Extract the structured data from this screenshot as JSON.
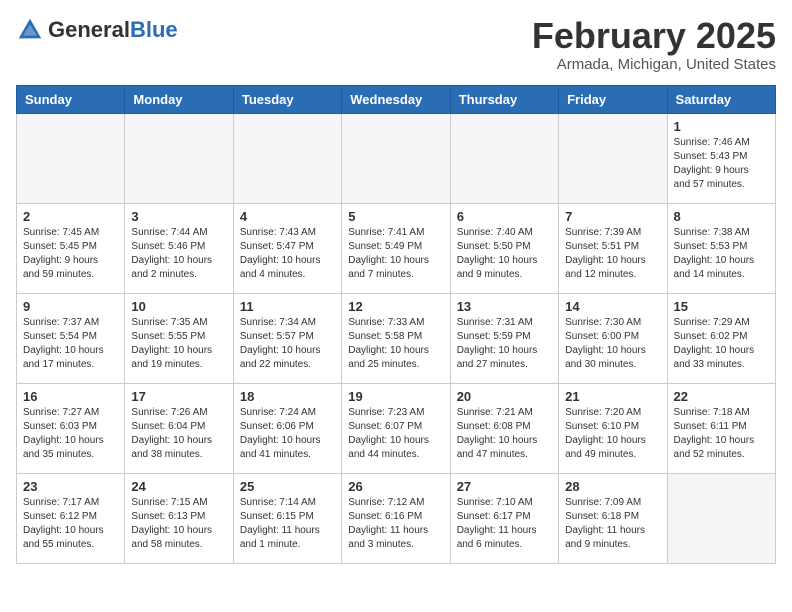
{
  "header": {
    "logo_general": "General",
    "logo_blue": "Blue",
    "month_title": "February 2025",
    "location": "Armada, Michigan, United States"
  },
  "weekdays": [
    "Sunday",
    "Monday",
    "Tuesday",
    "Wednesday",
    "Thursday",
    "Friday",
    "Saturday"
  ],
  "weeks": [
    [
      {
        "day": "",
        "info": ""
      },
      {
        "day": "",
        "info": ""
      },
      {
        "day": "",
        "info": ""
      },
      {
        "day": "",
        "info": ""
      },
      {
        "day": "",
        "info": ""
      },
      {
        "day": "",
        "info": ""
      },
      {
        "day": "1",
        "info": "Sunrise: 7:46 AM\nSunset: 5:43 PM\nDaylight: 9 hours\nand 57 minutes."
      }
    ],
    [
      {
        "day": "2",
        "info": "Sunrise: 7:45 AM\nSunset: 5:45 PM\nDaylight: 9 hours\nand 59 minutes."
      },
      {
        "day": "3",
        "info": "Sunrise: 7:44 AM\nSunset: 5:46 PM\nDaylight: 10 hours\nand 2 minutes."
      },
      {
        "day": "4",
        "info": "Sunrise: 7:43 AM\nSunset: 5:47 PM\nDaylight: 10 hours\nand 4 minutes."
      },
      {
        "day": "5",
        "info": "Sunrise: 7:41 AM\nSunset: 5:49 PM\nDaylight: 10 hours\nand 7 minutes."
      },
      {
        "day": "6",
        "info": "Sunrise: 7:40 AM\nSunset: 5:50 PM\nDaylight: 10 hours\nand 9 minutes."
      },
      {
        "day": "7",
        "info": "Sunrise: 7:39 AM\nSunset: 5:51 PM\nDaylight: 10 hours\nand 12 minutes."
      },
      {
        "day": "8",
        "info": "Sunrise: 7:38 AM\nSunset: 5:53 PM\nDaylight: 10 hours\nand 14 minutes."
      }
    ],
    [
      {
        "day": "9",
        "info": "Sunrise: 7:37 AM\nSunset: 5:54 PM\nDaylight: 10 hours\nand 17 minutes."
      },
      {
        "day": "10",
        "info": "Sunrise: 7:35 AM\nSunset: 5:55 PM\nDaylight: 10 hours\nand 19 minutes."
      },
      {
        "day": "11",
        "info": "Sunrise: 7:34 AM\nSunset: 5:57 PM\nDaylight: 10 hours\nand 22 minutes."
      },
      {
        "day": "12",
        "info": "Sunrise: 7:33 AM\nSunset: 5:58 PM\nDaylight: 10 hours\nand 25 minutes."
      },
      {
        "day": "13",
        "info": "Sunrise: 7:31 AM\nSunset: 5:59 PM\nDaylight: 10 hours\nand 27 minutes."
      },
      {
        "day": "14",
        "info": "Sunrise: 7:30 AM\nSunset: 6:00 PM\nDaylight: 10 hours\nand 30 minutes."
      },
      {
        "day": "15",
        "info": "Sunrise: 7:29 AM\nSunset: 6:02 PM\nDaylight: 10 hours\nand 33 minutes."
      }
    ],
    [
      {
        "day": "16",
        "info": "Sunrise: 7:27 AM\nSunset: 6:03 PM\nDaylight: 10 hours\nand 35 minutes."
      },
      {
        "day": "17",
        "info": "Sunrise: 7:26 AM\nSunset: 6:04 PM\nDaylight: 10 hours\nand 38 minutes."
      },
      {
        "day": "18",
        "info": "Sunrise: 7:24 AM\nSunset: 6:06 PM\nDaylight: 10 hours\nand 41 minutes."
      },
      {
        "day": "19",
        "info": "Sunrise: 7:23 AM\nSunset: 6:07 PM\nDaylight: 10 hours\nand 44 minutes."
      },
      {
        "day": "20",
        "info": "Sunrise: 7:21 AM\nSunset: 6:08 PM\nDaylight: 10 hours\nand 47 minutes."
      },
      {
        "day": "21",
        "info": "Sunrise: 7:20 AM\nSunset: 6:10 PM\nDaylight: 10 hours\nand 49 minutes."
      },
      {
        "day": "22",
        "info": "Sunrise: 7:18 AM\nSunset: 6:11 PM\nDaylight: 10 hours\nand 52 minutes."
      }
    ],
    [
      {
        "day": "23",
        "info": "Sunrise: 7:17 AM\nSunset: 6:12 PM\nDaylight: 10 hours\nand 55 minutes."
      },
      {
        "day": "24",
        "info": "Sunrise: 7:15 AM\nSunset: 6:13 PM\nDaylight: 10 hours\nand 58 minutes."
      },
      {
        "day": "25",
        "info": "Sunrise: 7:14 AM\nSunset: 6:15 PM\nDaylight: 11 hours\nand 1 minute."
      },
      {
        "day": "26",
        "info": "Sunrise: 7:12 AM\nSunset: 6:16 PM\nDaylight: 11 hours\nand 3 minutes."
      },
      {
        "day": "27",
        "info": "Sunrise: 7:10 AM\nSunset: 6:17 PM\nDaylight: 11 hours\nand 6 minutes."
      },
      {
        "day": "28",
        "info": "Sunrise: 7:09 AM\nSunset: 6:18 PM\nDaylight: 11 hours\nand 9 minutes."
      },
      {
        "day": "",
        "info": ""
      }
    ]
  ]
}
